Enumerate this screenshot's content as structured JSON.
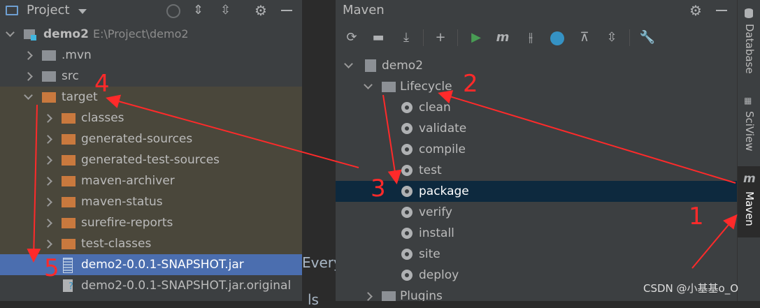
{
  "project_panel": {
    "title": "Project",
    "tree": [
      {
        "label": "demo2",
        "path": "E:\\Project\\demo2"
      },
      {
        "label": ".mvn"
      },
      {
        "label": "src"
      },
      {
        "label": "target"
      },
      {
        "label": "classes"
      },
      {
        "label": "generated-sources"
      },
      {
        "label": "generated-test-sources"
      },
      {
        "label": "maven-archiver"
      },
      {
        "label": "maven-status"
      },
      {
        "label": "surefire-reports"
      },
      {
        "label": "test-classes"
      },
      {
        "label": "demo2-0.0.1-SNAPSHOT.jar"
      },
      {
        "label": "demo2-0.0.1-SNAPSHOT.jar.original"
      }
    ]
  },
  "editor_fragment": {
    "text1": "Every",
    "text2": "ls"
  },
  "maven_panel": {
    "title": "Maven",
    "root": "demo2",
    "lifecycle": "Lifecycle",
    "phases": [
      "clean",
      "validate",
      "compile",
      "test",
      "package",
      "verify",
      "install",
      "site",
      "deploy"
    ],
    "plugins": "Plugins"
  },
  "side_tabs": [
    "Database",
    "SciView",
    "Maven"
  ],
  "annotations": [
    "1",
    "2",
    "3",
    "4",
    "5"
  ],
  "watermark": "CSDN @小基基o_O",
  "colors": {
    "panel_bg": "#3c3f41",
    "editor_bg": "#2b2b2b",
    "selected_row": "#4b6eaf",
    "maven_selected": "#0d293e",
    "excluded_folder_bg": "#4a473b",
    "annotation_red": "#ff2a2a"
  }
}
